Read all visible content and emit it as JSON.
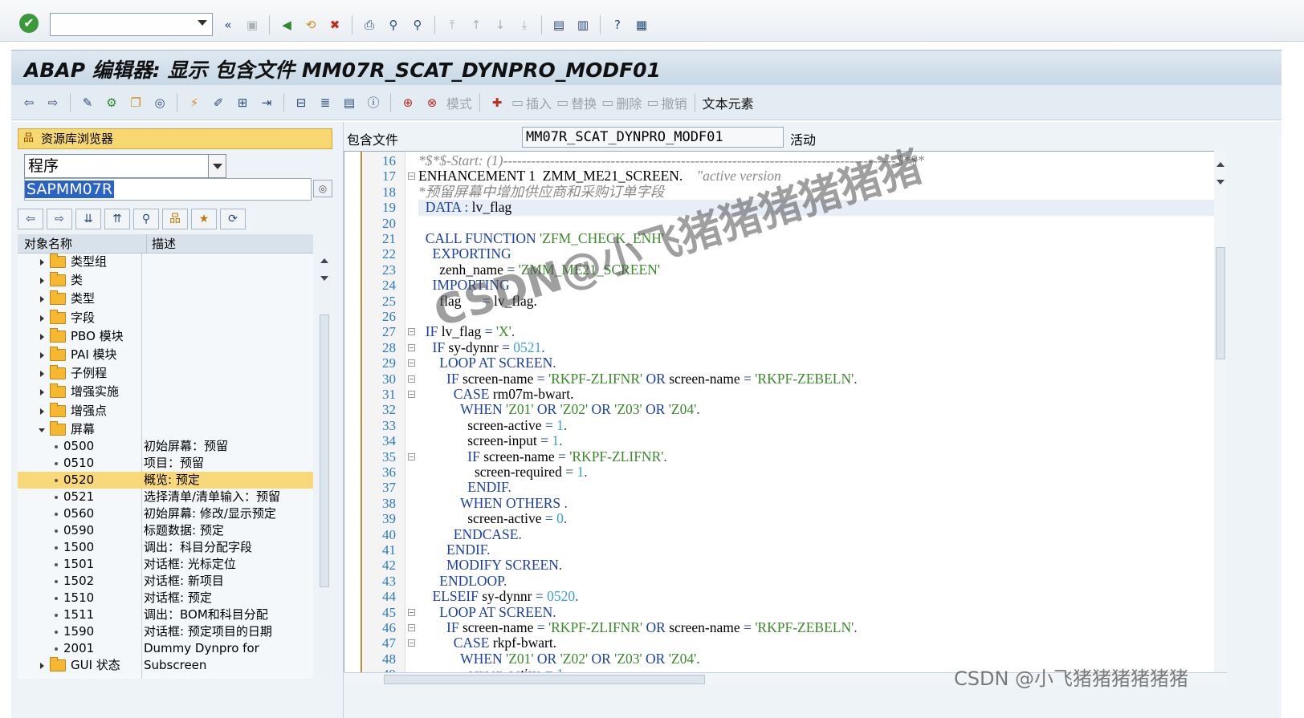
{
  "title": "ABAP 编辑器: 显示 包含文件 MM07R_SCAT_DYNPRO_MODF01",
  "app_toolbar": {
    "mode": "模式",
    "insert": "插入",
    "replace": "替换",
    "delete": "删除",
    "undo": "撤销",
    "text_elements": "文本元素"
  },
  "left": {
    "repo_header": "资源库浏览器",
    "object_type": "程序",
    "object_name": "SAPMM07R",
    "col_name": "对象名称",
    "col_desc": "描述",
    "folders": [
      "类型组",
      "类",
      "类型",
      "字段",
      "PBO 模块",
      "PAI 模块",
      "子例程",
      "增强实施",
      "增强点"
    ],
    "open_folder": "屏幕",
    "screens": [
      {
        "code": "0500",
        "desc": "初始屏幕：预留"
      },
      {
        "code": "0510",
        "desc": "项目：预留"
      },
      {
        "code": "0520",
        "desc": "概览: 预定"
      },
      {
        "code": "0521",
        "desc": "选择清单/清单输入：预留"
      },
      {
        "code": "0560",
        "desc": "初始屏幕: 修改/显示预定"
      },
      {
        "code": "0590",
        "desc": "标题数据: 预定"
      },
      {
        "code": "1500",
        "desc": "调出：科目分配字段"
      },
      {
        "code": "1501",
        "desc": "对话框: 光标定位"
      },
      {
        "code": "1502",
        "desc": "对话框: 新项目"
      },
      {
        "code": "1510",
        "desc": "对话框: 预定"
      },
      {
        "code": "1511",
        "desc": "调出：BOM和科目分配"
      },
      {
        "code": "1590",
        "desc": "对话框: 预定项目的日期"
      },
      {
        "code": "2001",
        "desc": "Dummy Dynpro for Subscreen"
      }
    ],
    "last_folder": "GUI 状态"
  },
  "right": {
    "include_label": "包含文件",
    "include_value": "MM07R_SCAT_DYNPRO_MODF01",
    "status": "活动"
  },
  "watermark": "CSDN@小飞猪猪猪猪猪猪",
  "watermark2": "CSDN @小飞猪猪猪猪猪猪",
  "colors": {
    "keyword": "#1a3fa6",
    "string": "#3a8a2a",
    "number": "#3aa0d8",
    "comment": "#8a8a8a",
    "highlight": "#f8d878"
  }
}
